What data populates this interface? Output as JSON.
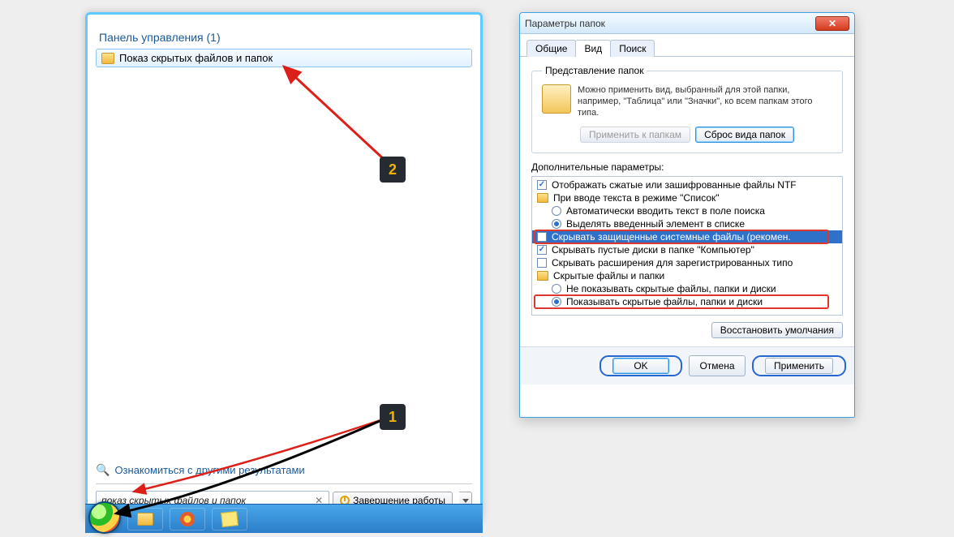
{
  "start_menu": {
    "header": "Панель управления (1)",
    "result_label": "Показ скрытых файлов и папок",
    "other_results_label": "Ознакомиться с другими результатами",
    "search_value": "показ скрытых файлов и папок",
    "shutdown_label": "Завершение работы"
  },
  "dialog": {
    "title": "Параметры папок",
    "tabs": {
      "general": "Общие",
      "view": "Вид",
      "search": "Поиск"
    },
    "folder_view": {
      "legend": "Представление папок",
      "text": "Можно применить вид, выбранный для этой папки, например, \"Таблица\" или \"Значки\", ко всем папкам этого типа.",
      "apply_button": "Применить к папкам",
      "reset_button": "Сброс вида папок"
    },
    "advanced_label": "Дополнительные параметры:",
    "items": {
      "i0": "Отображать сжатые или зашифрованные файлы NTF",
      "i1": "При вводе текста в режиме \"Список\"",
      "i2": "Автоматически вводить текст в поле поиска",
      "i3": "Выделять введенный элемент в списке",
      "i4": "Скрывать защищенные системные файлы (рекомен.",
      "i5": "Скрывать пустые диски в папке \"Компьютер\"",
      "i6": "Скрывать расширения для зарегистрированных типо",
      "i7": "Скрытые файлы и папки",
      "i8": "Не показывать скрытые файлы, папки и диски",
      "i9": "Показывать скрытые файлы, папки и диски"
    },
    "restore_button": "Восстановить умолчания",
    "ok": "OK",
    "cancel": "Отмена",
    "apply": "Применить"
  },
  "annotations": {
    "one": "1",
    "two": "2"
  }
}
